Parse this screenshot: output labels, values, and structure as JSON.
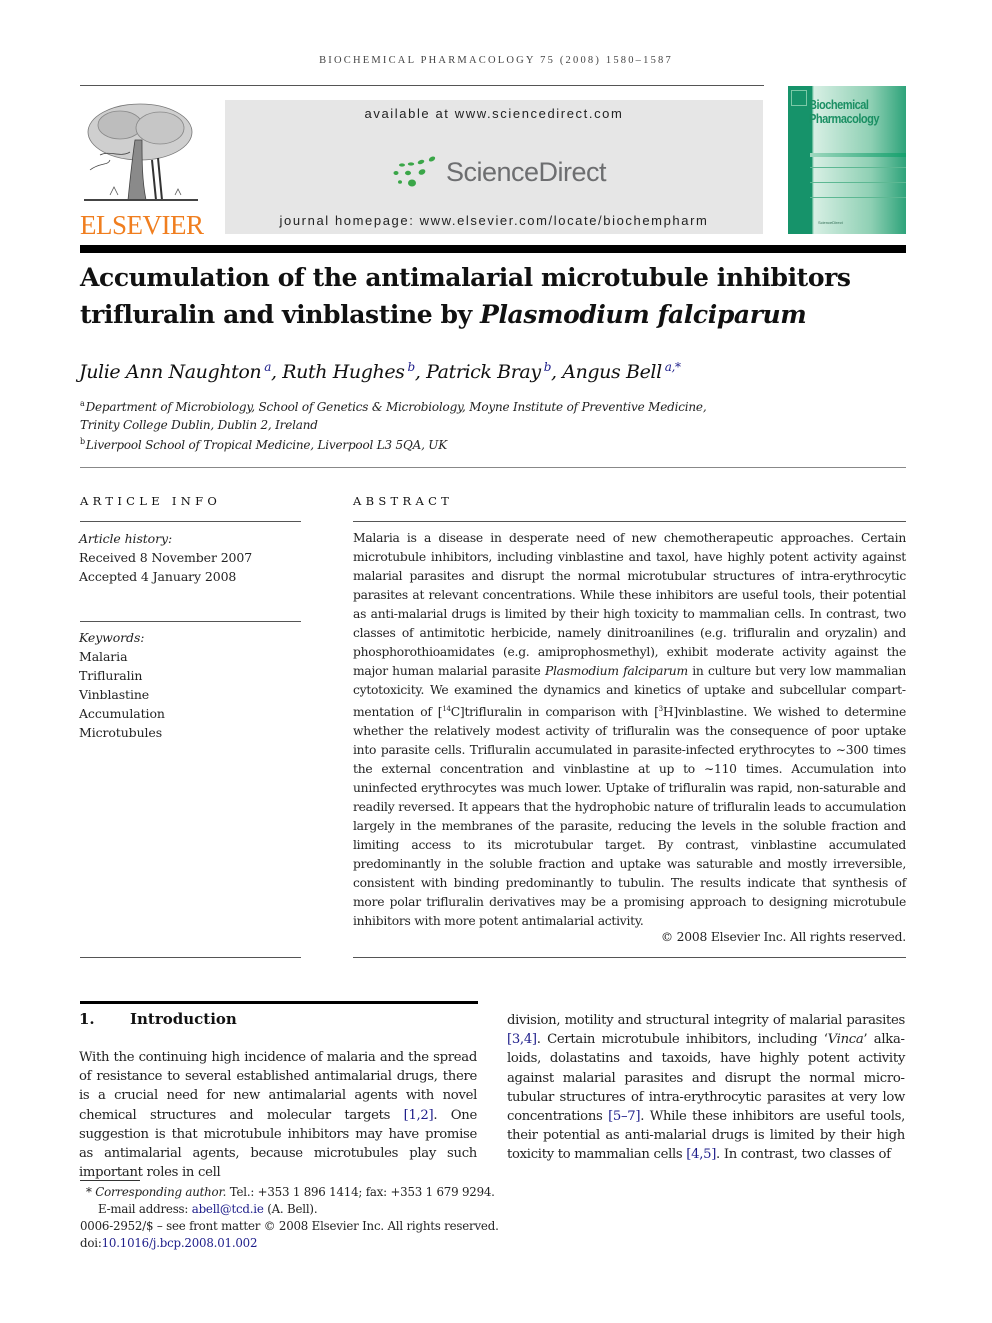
{
  "header": {
    "running_head": "BIOCHEMICAL PHARMACOLOGY 75 (2008) 1580–1587",
    "publisher_logo_text": "ELSEVIER",
    "available_at": "available at www.sciencedirect.com",
    "sciencedirect_logo_text": "ScienceDirect",
    "journal_homepage": "journal homepage: www.elsevier.com/locate/biochempharm",
    "cover": {
      "title_line1": "Biochemical",
      "title_line2": "Pharmacology",
      "footer_text": "ScienceDirect"
    },
    "colors": {
      "elsevier_orange": "#f07e1f",
      "sciencedirect_green": "#3aa648",
      "cover_green": "#1f9c6e",
      "link_blue": "#1d1d8a"
    }
  },
  "article": {
    "title_line1": "Accumulation of the antimalarial microtubule inhibitors",
    "title_line2_prefix": "trifluralin and vinblastine by ",
    "title_line2_italic": "Plasmodium falciparum",
    "authors": [
      {
        "name": "Julie Ann Naughton",
        "sup": "a"
      },
      {
        "name": "Ruth Hughes",
        "sup": "b"
      },
      {
        "name": "Patrick Bray",
        "sup": "b"
      },
      {
        "name": "Angus Bell",
        "sup": "a,*"
      }
    ],
    "affiliations": [
      {
        "mark": "a",
        "line1": "Department of Microbiology, School of Genetics & Microbiology, Moyne Institute of Preventive Medicine,",
        "line2": "Trinity College Dublin, Dublin 2, Ireland"
      },
      {
        "mark": "b",
        "line1": "Liverpool School of Tropical Medicine, Liverpool L3 5QA, UK"
      }
    ]
  },
  "article_info": {
    "heading": "ARTICLE INFO",
    "history_label": "Article history:",
    "received": "Received 8 November 2007",
    "accepted": "Accepted 4 January 2008",
    "keywords_label": "Keywords:",
    "keywords": [
      "Malaria",
      "Trifluralin",
      "Vinblastine",
      "Accumulation",
      "Microtubules"
    ]
  },
  "abstract": {
    "heading": "ABSTRACT",
    "part1": "Malaria is a disease in desperate need of new chemotherapeutic approaches. Certain microtubule inhibitors, including vinblastine and taxol, have highly potent activity against malarial parasites and disrupt the normal microtubular structures of intra-erythrocytic parasites at relevant concentrations. While these inhibitors are useful tools, their potential as anti-malarial drugs is limited by their high toxicity to mammalian cells. In contrast, two classes of antimitotic herbicide, namely dinitroanilines (e.g. trifluralin and oryzalin) and phosphorothioamidates (e.g. amiprophosmethyl), exhibit moderate activity against the major human malarial parasite ",
    "species": "Plasmodium falciparum",
    "part2": " in culture but very low mammalian cytotoxicity. We examined the dynamics and kinetics of uptake and subcellular compart­mentation of [",
    "iso1": "14",
    "part3": "C]trifluralin in comparison with [",
    "iso2": "3",
    "part4": "H]vinblastine. We wished to determine whether the relatively modest activity of trifluralin was the consequence of poor uptake into parasite cells. Trifluralin accumulated in parasite-infected erythrocytes to ∼300 times the external concentration and vinblastine at up to ∼110 times. Accumulation into uninfected erythrocytes was much lower. Uptake of trifluralin was rapid, non-saturable and readily reversed. It appears that the hydrophobic nature of trifluralin leads to accumulation largely in the membranes of the parasite, reducing the levels in the soluble fraction and limiting access to its microtubular target. By contrast, vinblastine accumulated predominantly in the soluble fraction and uptake was saturable and mostly irreversible, consistent with binding predominantly to tubulin. The results indicate that synthesis of more polar trifluralin derivatives may be a promising approach to designing microtubule inhibitors with more potent antimalarial activity.",
    "copyright": "© 2008 Elsevier Inc. All rights reserved."
  },
  "introduction": {
    "number": "1.",
    "heading": "Introduction",
    "col1": [
      {
        "t": "With the continuing high incidence of malaria and the spread of resistance to several established antimalarial drugs, there is a crucial need for new antimalarial agents with novel chemical structures and molecular targets "
      },
      {
        "ref": "[1,2]"
      },
      {
        "t": ". One suggestion is that microtubule inhibitors may have promise as antimalarial agents, because microtubules play such important roles in cell"
      }
    ],
    "col2": [
      {
        "t": "division, motility and structural integrity of malarial parasites "
      },
      {
        "ref": "[3,4]"
      },
      {
        "t": ". Certain microtubule inhibitors, including ‘"
      },
      {
        "i": "Vinca"
      },
      {
        "t": "’ alka­loids, dolastatins and taxoids, have highly potent activity against malarial parasites and disrupt the normal micro­tubular structures of intra-erythrocytic parasites at very low concentrations "
      },
      {
        "ref": "[5–7]"
      },
      {
        "t": ". While these inhibitors are useful tools, their potential as anti-malarial drugs is limited by their high toxicity to mammalian cells "
      },
      {
        "ref": "[4,5]"
      },
      {
        "t": ". In contrast, two classes of"
      }
    ]
  },
  "footnotes": {
    "star": "*",
    "corresponding_label": "Corresponding author.",
    "contact": " Tel.: +353 1 896 1414; fax: +353 1 679 9294.",
    "email_label": "E-mail address: ",
    "email": "abell@tcd.ie",
    "email_suffix": " (A. Bell).",
    "front_matter": "0006-2952/$ – see front matter © 2008 Elsevier Inc. All rights reserved.",
    "doi_label": "doi:",
    "doi": "10.1016/j.bcp.2008.01.002"
  }
}
